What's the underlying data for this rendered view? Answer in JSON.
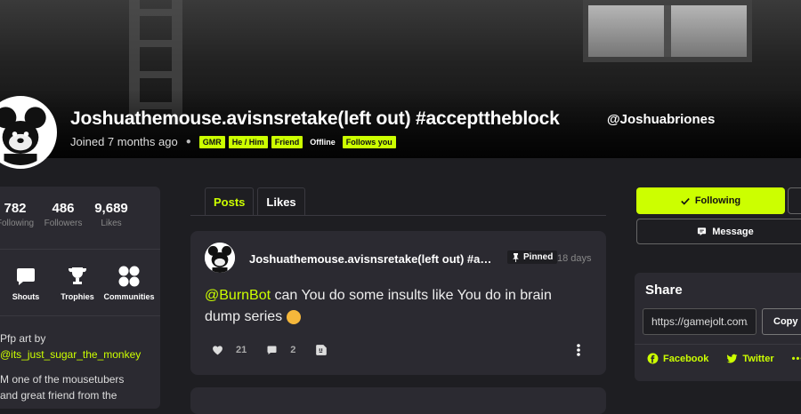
{
  "profile": {
    "display_name": "Joshuathemouse.avisnsretake(left out) #accepttheblock",
    "handle": "@Joshuabriones",
    "joined": "Joined 7 months ago",
    "tags": [
      "GMR",
      "He / Him",
      "Friend",
      "Offline",
      "Follows you"
    ]
  },
  "stats": [
    {
      "value": "782",
      "label": "Following"
    },
    {
      "value": "486",
      "label": "Followers"
    },
    {
      "value": "9,689",
      "label": "Likes"
    }
  ],
  "quick_links": [
    {
      "label": "Shouts",
      "icon": "chat-bubble-icon"
    },
    {
      "label": "Trophies",
      "icon": "trophy-icon"
    },
    {
      "label": "Communities",
      "icon": "communities-icon"
    }
  ],
  "bio": {
    "line1": "Pfp art by",
    "link": "@its_just_sugar_the_monkey",
    "line3": "M one of the mousetubers",
    "line4": "and great friend from the"
  },
  "tabs": [
    {
      "label": "Posts",
      "active": true
    },
    {
      "label": "Likes",
      "active": false
    }
  ],
  "post": {
    "author": "Joshuathemouse.avisnsretake(left out) #accepttheblock",
    "pinned_label": "Pinned",
    "time_ago": "18 days",
    "mention": "@BurnBot",
    "text": " can You do some insults like You do in brain dump series ",
    "likes": "21",
    "comments": "2"
  },
  "sidebar": {
    "following_label": "Following",
    "message_label": "Message"
  },
  "share": {
    "title": "Share",
    "url": "https://gamejolt.com/@Joshuabriones",
    "copy_label": "Copy",
    "facebook_label": "Facebook",
    "twitter_label": "Twitter",
    "more_label": "•••"
  },
  "colors": {
    "accent": "#ccff00",
    "background": "#1e1e22",
    "card": "#2b2a31"
  }
}
